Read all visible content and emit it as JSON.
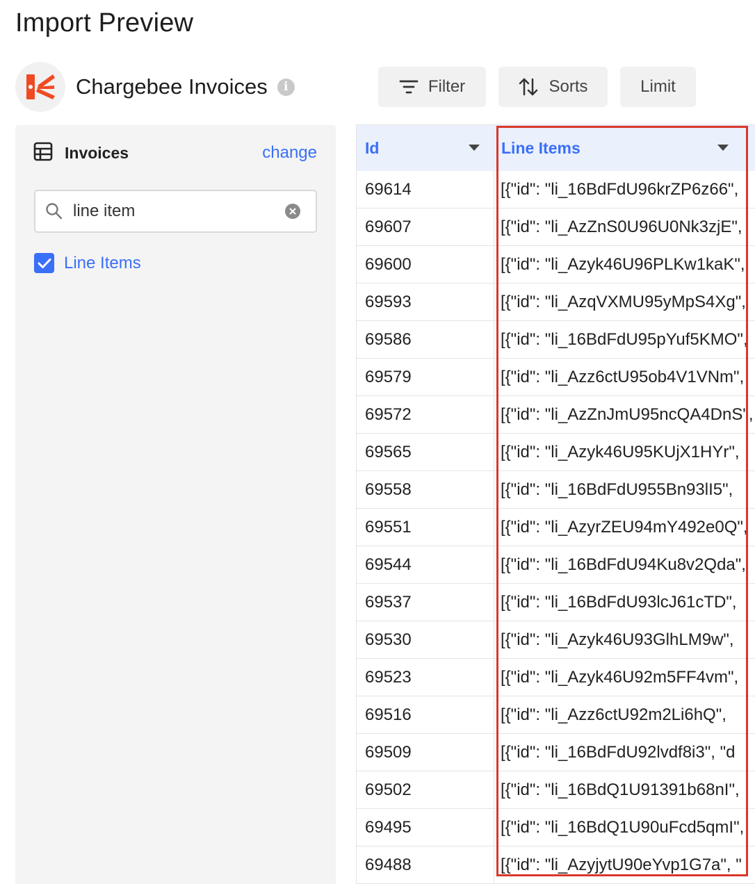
{
  "page_title": "Import Preview",
  "source": {
    "name": "Chargebee Invoices",
    "info_icon": "info-icon",
    "brand_color": "#f04a23"
  },
  "toolbar": {
    "filter_label": "Filter",
    "sorts_label": "Sorts",
    "limit_label": "Limit"
  },
  "sidebar": {
    "title": "Invoices",
    "change_label": "change",
    "search": {
      "value": "line item",
      "placeholder": ""
    },
    "fields": [
      {
        "label": "Line Items",
        "checked": true
      }
    ]
  },
  "table": {
    "columns": [
      "Id",
      "Line Items"
    ],
    "rows": [
      [
        "69614",
        "[{\"id\": \"li_16BdFdU96krZP6z66\", "
      ],
      [
        "69607",
        "[{\"id\": \"li_AzZnS0U96U0Nk3zjE\", "
      ],
      [
        "69600",
        "[{\"id\": \"li_Azyk46U96PLKw1kaK\", "
      ],
      [
        "69593",
        "[{\"id\": \"li_AzqVXMU95yMpS4Xg\", "
      ],
      [
        "69586",
        "[{\"id\": \"li_16BdFdU95pYuf5KMO\", "
      ],
      [
        "69579",
        "[{\"id\": \"li_Azz6ctU95ob4V1VNm\", "
      ],
      [
        "69572",
        "[{\"id\": \"li_AzZnJmU95ncQA4DnS\", "
      ],
      [
        "69565",
        "[{\"id\": \"li_Azyk46U95KUjX1HYr\", "
      ],
      [
        "69558",
        "[{\"id\": \"li_16BdFdU955Bn93lI5\", "
      ],
      [
        "69551",
        "[{\"id\": \"li_AzyrZEU94mY492e0Q\", "
      ],
      [
        "69544",
        "[{\"id\": \"li_16BdFdU94Ku8v2Qda\", "
      ],
      [
        "69537",
        "[{\"id\": \"li_16BdFdU93lcJ61cTD\", "
      ],
      [
        "69530",
        "[{\"id\": \"li_Azyk46U93GlhLM9w\", "
      ],
      [
        "69523",
        "[{\"id\": \"li_Azyk46U92m5FF4vm\", "
      ],
      [
        "69516",
        "[{\"id\": \"li_Azz6ctU92m2Li6hQ\", "
      ],
      [
        "69509",
        "[{\"id\": \"li_16BdFdU92lvdf8i3\", \"d"
      ],
      [
        "69502",
        "[{\"id\": \"li_16BdQ1U91391b68nI\", "
      ],
      [
        "69495",
        "[{\"id\": \"li_16BdQ1U90uFcd5qmI\", "
      ],
      [
        "69488",
        "[{\"id\": \"li_AzyjytU90eYvp1G7a\", \""
      ]
    ]
  },
  "highlight_color": "#d9372a"
}
